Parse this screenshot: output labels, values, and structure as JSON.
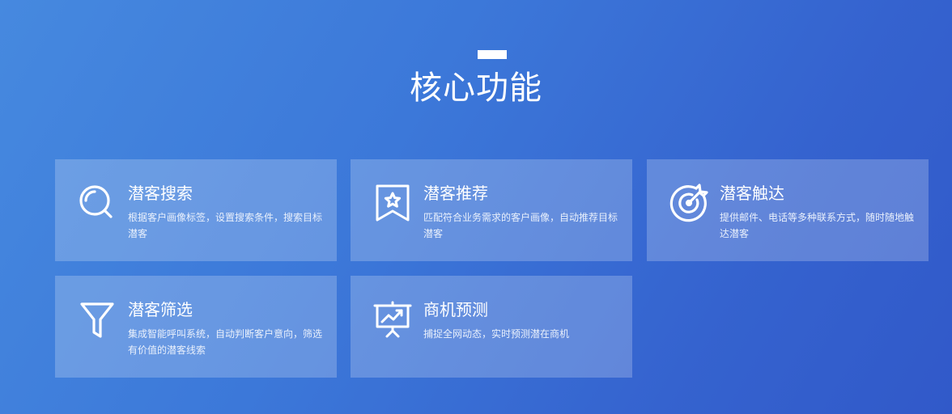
{
  "section": {
    "title": "核心功能"
  },
  "cards": [
    {
      "icon": "search-icon",
      "title": "潜客搜索",
      "desc": "根据客户画像标签，设置搜索条件，搜索目标潜客"
    },
    {
      "icon": "bookmark-star-icon",
      "title": "潜客推荐",
      "desc": "匹配符合业务需求的客户画像，自动推荐目标潜客"
    },
    {
      "icon": "target-reach-icon",
      "title": "潜客触达",
      "desc": "提供邮件、电话等多种联系方式，随时随地触达潜客"
    },
    {
      "icon": "filter-icon",
      "title": "潜客筛选",
      "desc": "集成智能呼叫系统，自动判断客户意向，筛选有价值的潜客线索"
    },
    {
      "icon": "presentation-chart-icon",
      "title": "商机预测",
      "desc": "捕捉全网动态，实时预测潜在商机"
    }
  ]
}
